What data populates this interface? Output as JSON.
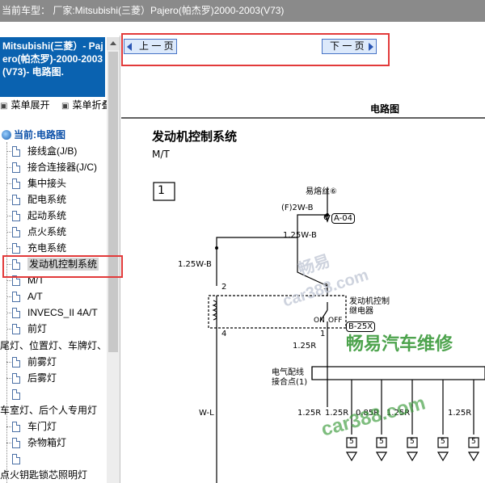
{
  "topbar": {
    "text": "当前车型：  厂家:Mitsubishi(三菱）Pajero(帕杰罗)2000-2003(V73)"
  },
  "sidebar": {
    "title": "Mitsubishi(三菱）- Pajero(帕杰罗)-2000-2003(V73)- 电路图.",
    "expand_label": "菜单展开",
    "collapse_label": "菜单折叠",
    "current_label": "当前:电路图",
    "items": [
      "接线盒(J/B)",
      "接合连接器(J/C)",
      "集中接头",
      "配电系统",
      "起动系统",
      "点火系统",
      "充电系统",
      "发动机控制系统",
      "M/T",
      "A/T",
      "INVECS_II 4A/T",
      "前灯",
      "尾灯、位置灯、车牌灯、",
      "前雾灯",
      "后雾灯",
      "车室灯、后个人专用灯",
      "车门灯",
      "杂物箱灯",
      "",
      "点火钥匙锁芯照明灯"
    ]
  },
  "nav": {
    "prev_label": "上 一 页",
    "next_label": "下 一 页"
  },
  "diagram": {
    "header": "电路图",
    "title": "发动机控制系统",
    "subtitle": "M/T",
    "box_number": "1",
    "fuse_label": "易熔丝⑥",
    "wire_f": "(F)2W-B",
    "pin_6": "6",
    "conn_a04": "A-04",
    "wire_125wb_top": "1.25W-B",
    "wire_125wb_left": "1.25W-B",
    "pin_2": "2",
    "pin_3": "3",
    "pin_1": "1",
    "pin_4": "4",
    "relay_label_1": "发动机控制",
    "relay_label_2": "继电器",
    "on_label": "ON",
    "off_label": "OFF",
    "conn_b25x": "B-25X",
    "wire_125r_mid": "1.25R",
    "splice_label_1": "电气配线",
    "splice_label_2": "接合点(1)",
    "wire_wl": "W-L",
    "bottom_wires": [
      "1.25R",
      "1.25R",
      "0.85R",
      "1.25R",
      "1.25R"
    ],
    "bottom_pins": [
      "5",
      "5",
      "5",
      "5",
      "5"
    ]
  },
  "watermarks": [
    "畅易",
    "car388.com",
    "畅易汽车维修",
    "car388.com"
  ],
  "colors": {
    "topbar": "#8a8a8a",
    "title_bg": "#0a62b0",
    "highlight": "#e23a3a",
    "nav_btn": "#dce9fb",
    "watermark_green": "#3a9a3a"
  }
}
